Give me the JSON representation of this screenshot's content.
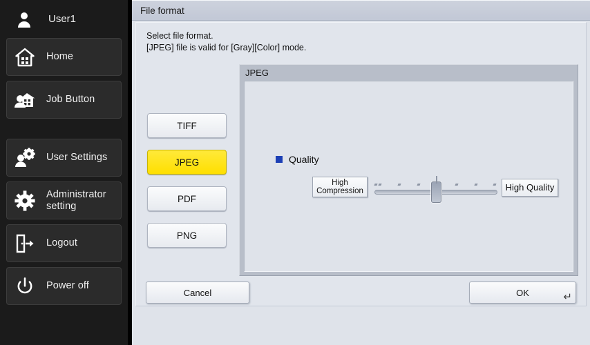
{
  "sidebar": {
    "user": {
      "icon": "person-icon",
      "label": "User1"
    },
    "items": [
      {
        "icon": "home-icon",
        "label": "Home"
      },
      {
        "icon": "job-button-icon",
        "label": "Job Button"
      },
      {
        "icon": "user-settings-icon",
        "label": "User Settings"
      },
      {
        "icon": "gear-icon",
        "label": "Administrator\nsetting"
      },
      {
        "icon": "logout-icon",
        "label": "Logout"
      },
      {
        "icon": "power-icon",
        "label": "Power off"
      }
    ]
  },
  "dialog": {
    "title": "File format",
    "instructions": "Select file format.\n[JPEG] file is valid for [Gray][Color] mode.",
    "format_buttons": [
      {
        "label": "TIFF",
        "selected": false
      },
      {
        "label": "JPEG",
        "selected": true
      },
      {
        "label": "PDF",
        "selected": false
      },
      {
        "label": "PNG",
        "selected": false
      }
    ],
    "jpeg_group": {
      "title": "JPEG",
      "quality": {
        "marker_color": "#1c3fb5",
        "label": "Quality",
        "low_end_label": "High\nCompression",
        "high_end_label": "High Quality",
        "tick_count": 7,
        "value": 4,
        "min": 1,
        "max": 7
      }
    },
    "footer": {
      "cancel_label": "Cancel",
      "ok_label": "OK",
      "ok_enter_icon": "enter-key-icon"
    }
  },
  "colors": {
    "sidebar_bg": "#1b1b1b",
    "nav_item_bg": "#2b2b2b",
    "dialog_bg": "#dfe3ea",
    "titlebar_bg": "#c7ccd9",
    "selected_button": "#ffdf00",
    "group_frame": "#b8bec9"
  }
}
